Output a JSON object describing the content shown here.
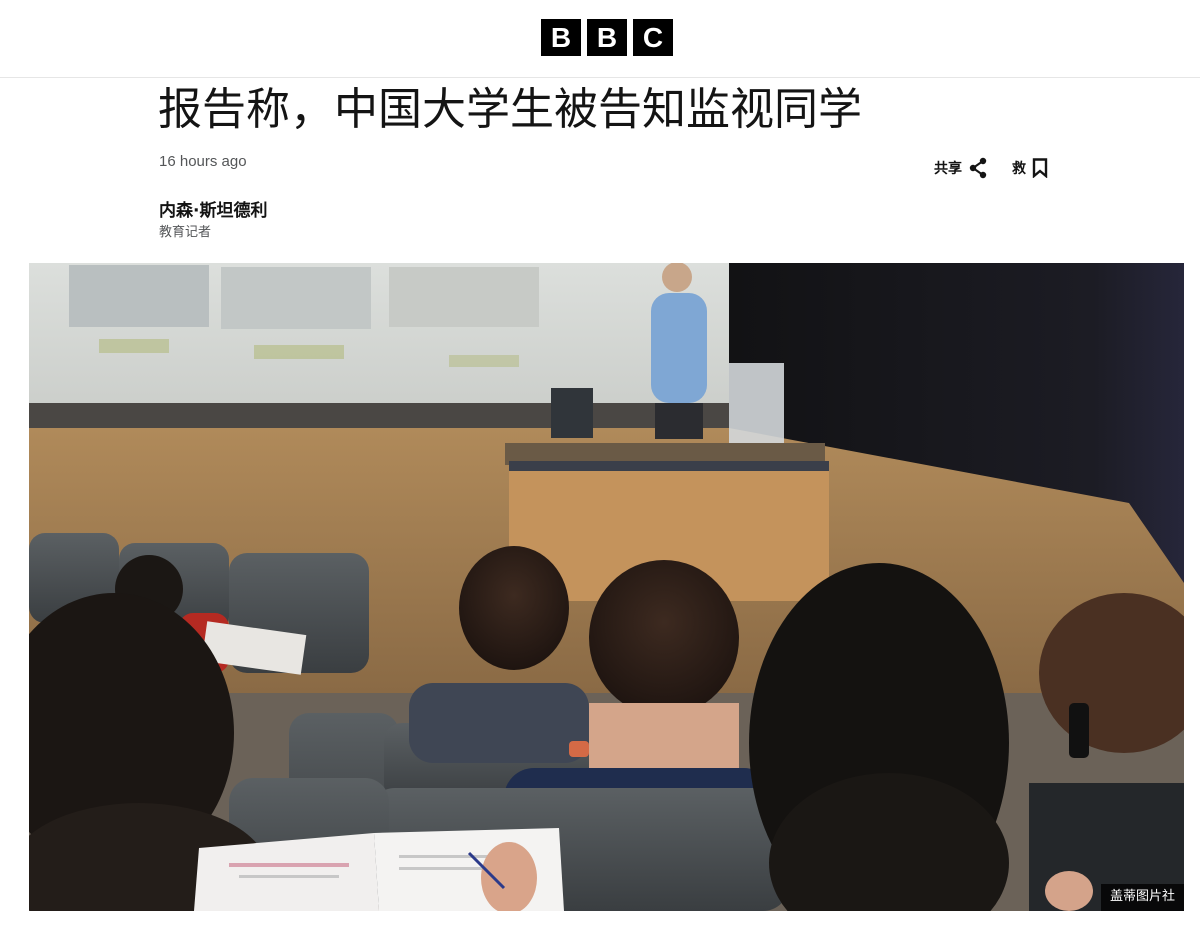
{
  "header": {
    "logo_letters": [
      "B",
      "B",
      "C"
    ]
  },
  "article": {
    "headline": "报告称，中国大学生被告知监视同学",
    "timestamp": "16 hours ago",
    "author": "内森·斯坦德利",
    "author_role": "教育记者",
    "actions": {
      "share_label": "共享",
      "save_label": "救",
      "share_icon": "share-icon",
      "save_icon": "bookmark-icon"
    },
    "image": {
      "description": "lecture-hall-photo",
      "credit": "盖蒂图片社"
    }
  },
  "colors": {
    "text": "#141414",
    "muted": "#545658",
    "divider": "#e6e6e6",
    "logo_bg": "#000000"
  }
}
